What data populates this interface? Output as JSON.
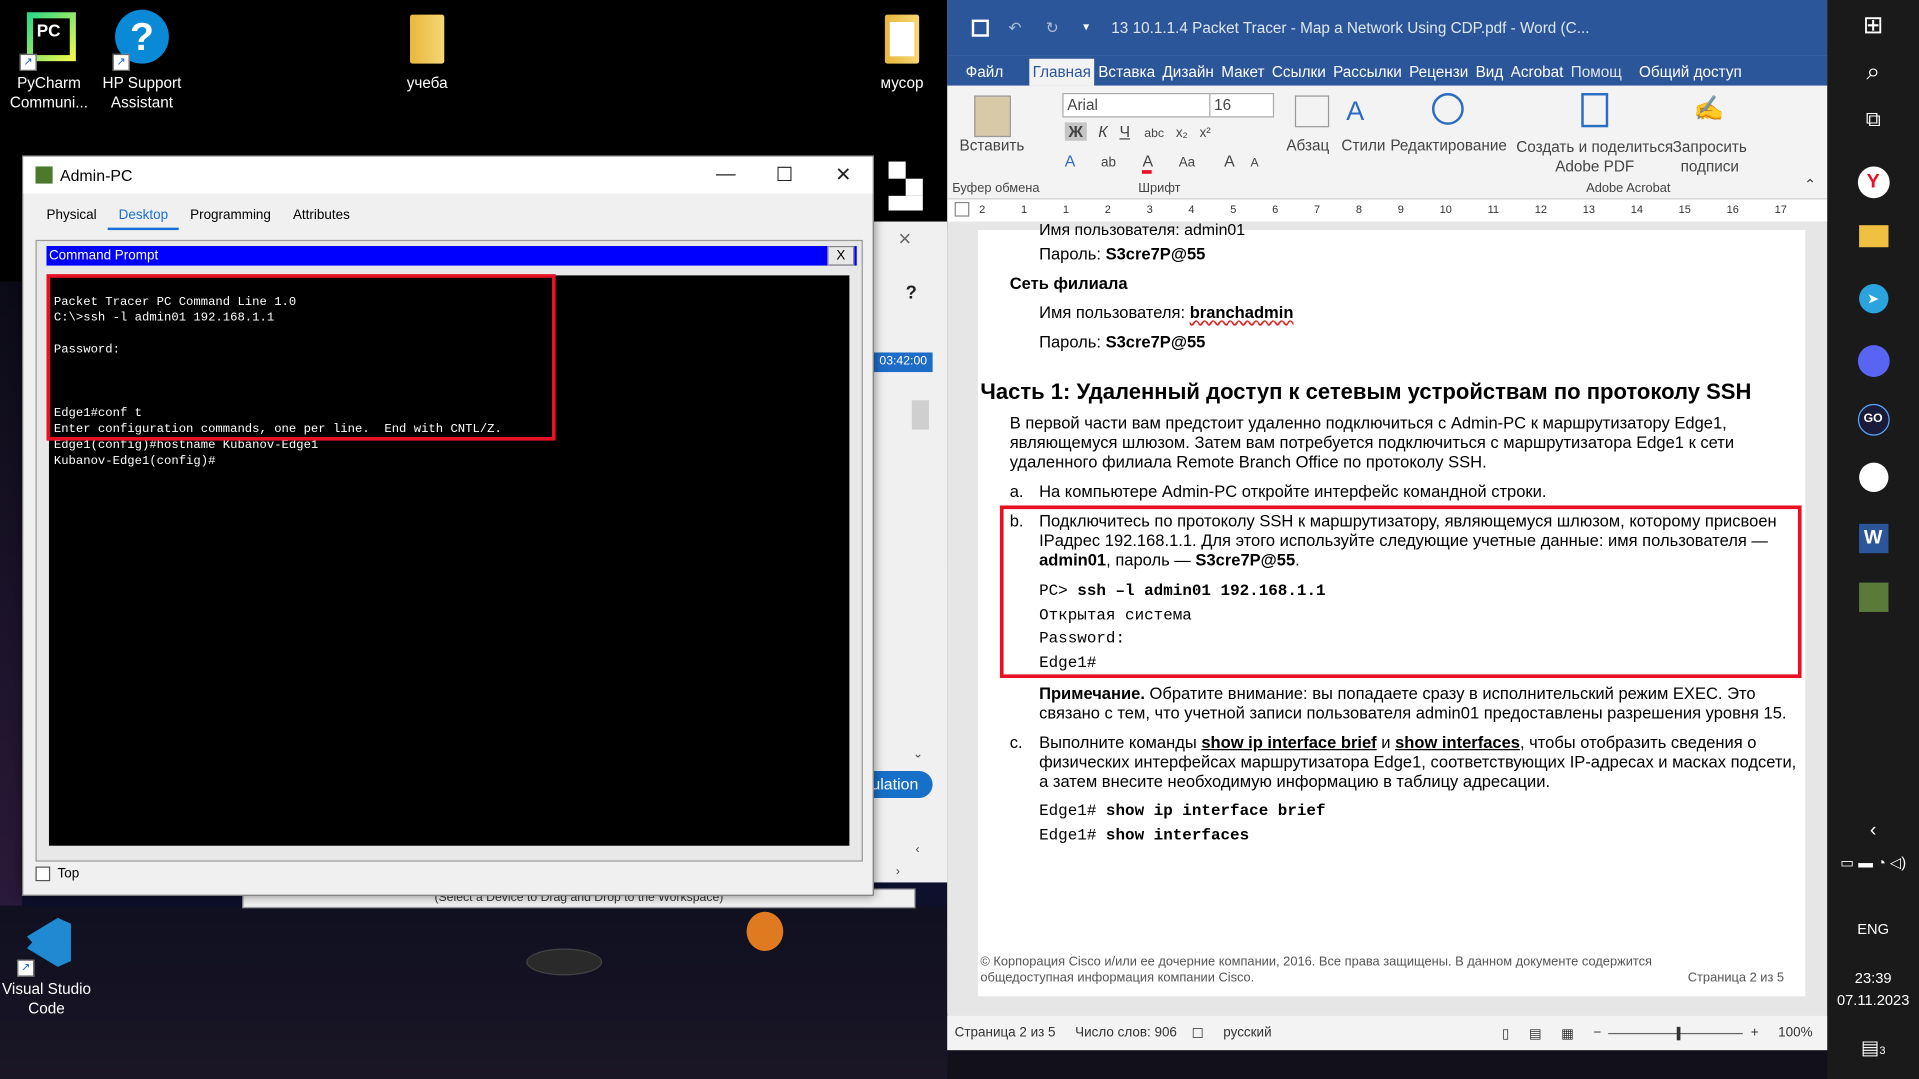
{
  "desktop": {
    "icons": [
      {
        "label": "PyCharm Communi...",
        "icon": "pycharm-icon"
      },
      {
        "label": "HP Support Assistant",
        "icon": "hp-support-icon"
      },
      {
        "label": "учеба",
        "icon": "folder-icon"
      },
      {
        "label": "мусор",
        "icon": "folder-icon"
      },
      {
        "label": "Visual Studio Code",
        "icon": "vscode-icon"
      }
    ]
  },
  "admin_pc": {
    "title": "Admin-PC",
    "tabs": [
      "Physical",
      "Desktop",
      "Programming",
      "Attributes"
    ],
    "cmd_title": "Command Prompt",
    "cmd_close": "X",
    "terminal_lines": [
      "Packet Tracer PC Command Line 1.0",
      "C:\\>ssh -l admin01 192.168.1.1",
      "",
      "Password:",
      "",
      "",
      "",
      "Edge1#conf t",
      "Enter configuration commands, one per line.  End with CNTL/Z.",
      "Edge1(config)#hostname Kubanov-Edge1",
      "Kubanov-Edge1(config)#"
    ],
    "top_checkbox": "Top"
  },
  "packet_tracer_bg": {
    "time": "03:42:00",
    "help": "?",
    "sim": "ulation",
    "drag_hint": "(Select a Device to Drag and Drop to the Workspace)"
  },
  "word": {
    "title": "13 10.1.1.4 Packet Tracer - Map a Network Using CDP.pdf - Word (C...",
    "menu": [
      "Файл",
      "Главная",
      "Вставка",
      "Дизайн",
      "Макет",
      "Ссылки",
      "Рассылки",
      "Рецензи",
      "Вид",
      "Acrobat",
      "Помощ",
      "Общий доступ"
    ],
    "ribbon": {
      "paste": "Вставить",
      "clipboard": "Буфер обмена",
      "font_name": "Arial",
      "font_size": "16",
      "font_group": "Шрифт",
      "paragraph": "Абзац",
      "styles": "Стили",
      "editing": "Редактирование",
      "acrobat_create": "Создать и поделиться Adobe PDF",
      "acrobat_request": "Запросить подписи",
      "acrobat_group": "Adobe Acrobat"
    },
    "ruler_numbers": [
      "2",
      "1",
      "1",
      "2",
      "3",
      "4",
      "5",
      "6",
      "7",
      "8",
      "9",
      "10",
      "11",
      "12",
      "13",
      "14",
      "15",
      "16",
      "17"
    ],
    "doc": {
      "cut_top": "Имя пользователя: admin01",
      "pw1_label": "Пароль: ",
      "pw1": "S3cre7P@55",
      "branch_head": "Сеть филиала",
      "user_label": "Имя пользователя: ",
      "user": "branchadmin",
      "pw2_label": "Пароль: ",
      "pw2": "S3cre7P@55",
      "heading": "Часть 1: Удаленный доступ к сетевым устройствам по протоколу SSH",
      "intro": [
        "В первой части вам предстоит удаленно подключиться с Admin-PC к маршрутизатору Edge1,",
        "являющемуся шлюзом. Затем вам потребуется подключиться с маршрутизатора Edge1 к сети",
        "удаленного филиала Remote Branch Office по протоколу SSH."
      ],
      "a_mark": "a.",
      "a_text": "На компьютере Admin-PC откройте интерфейс командной строки.",
      "b_mark": "b.",
      "b_lines": [
        "Подключитесь по протоколу SSH к маршрутизатору, являющемуся шлюзом, которому присвоен",
        "IPадрес 192.168.1.1. Для этого используйте следующие учетные данные: имя пользователя —"
      ],
      "b_user": "admin01",
      "b_mid": ", пароль — ",
      "b_pw": "S3cre7P@55",
      "b_end": ".",
      "code_prompt": "PC> ",
      "code_cmd": "ssh –l admin01 192.168.1.1",
      "code_open": "Открытая система",
      "code_pw": "Password:",
      "code_edge": "Edge1#",
      "note_bold": "Примечание.",
      "note_rest": " Обратите внимание: вы попадаете сразу в исполнительский режим EXEC. Это",
      "note_line2": "связано с тем, что учетной записи пользователя admin01 предоставлены разрешения уровня 15.",
      "c_mark": "c.",
      "c_pre": "Выполните команды ",
      "c_cmd1": "show ip interface brief",
      "c_and": " и ",
      "c_cmd2": "show interfaces",
      "c_post": ", чтобы отобразить сведения о",
      "c_line2": "физических интерфейсах маршрутизатора Edge1, соответствующих IP-адресах и масках подсети,",
      "c_line3": "а затем внесите необходимую информацию в таблицу адресации.",
      "cmd1_prompt": "Edge1# ",
      "cmd1": "show ip interface brief",
      "cmd2_prompt": "Edge1# ",
      "cmd2": "show interfaces",
      "footer1": "© Корпорация Cisco и/или ее дочерние компании, 2016. Все права защищены. В данном документе содержится",
      "footer2": "общедоступная информация компании Cisco.",
      "page_label": "Страница 2 из 5"
    },
    "status": {
      "page": "Страница 2 из 5",
      "words": "Число слов: 906",
      "lang": "русский",
      "zoom": "100%"
    }
  },
  "taskbar": {
    "lang": "ENG",
    "time": "23:39",
    "date": "07.11.2023",
    "notif_count": "3"
  }
}
